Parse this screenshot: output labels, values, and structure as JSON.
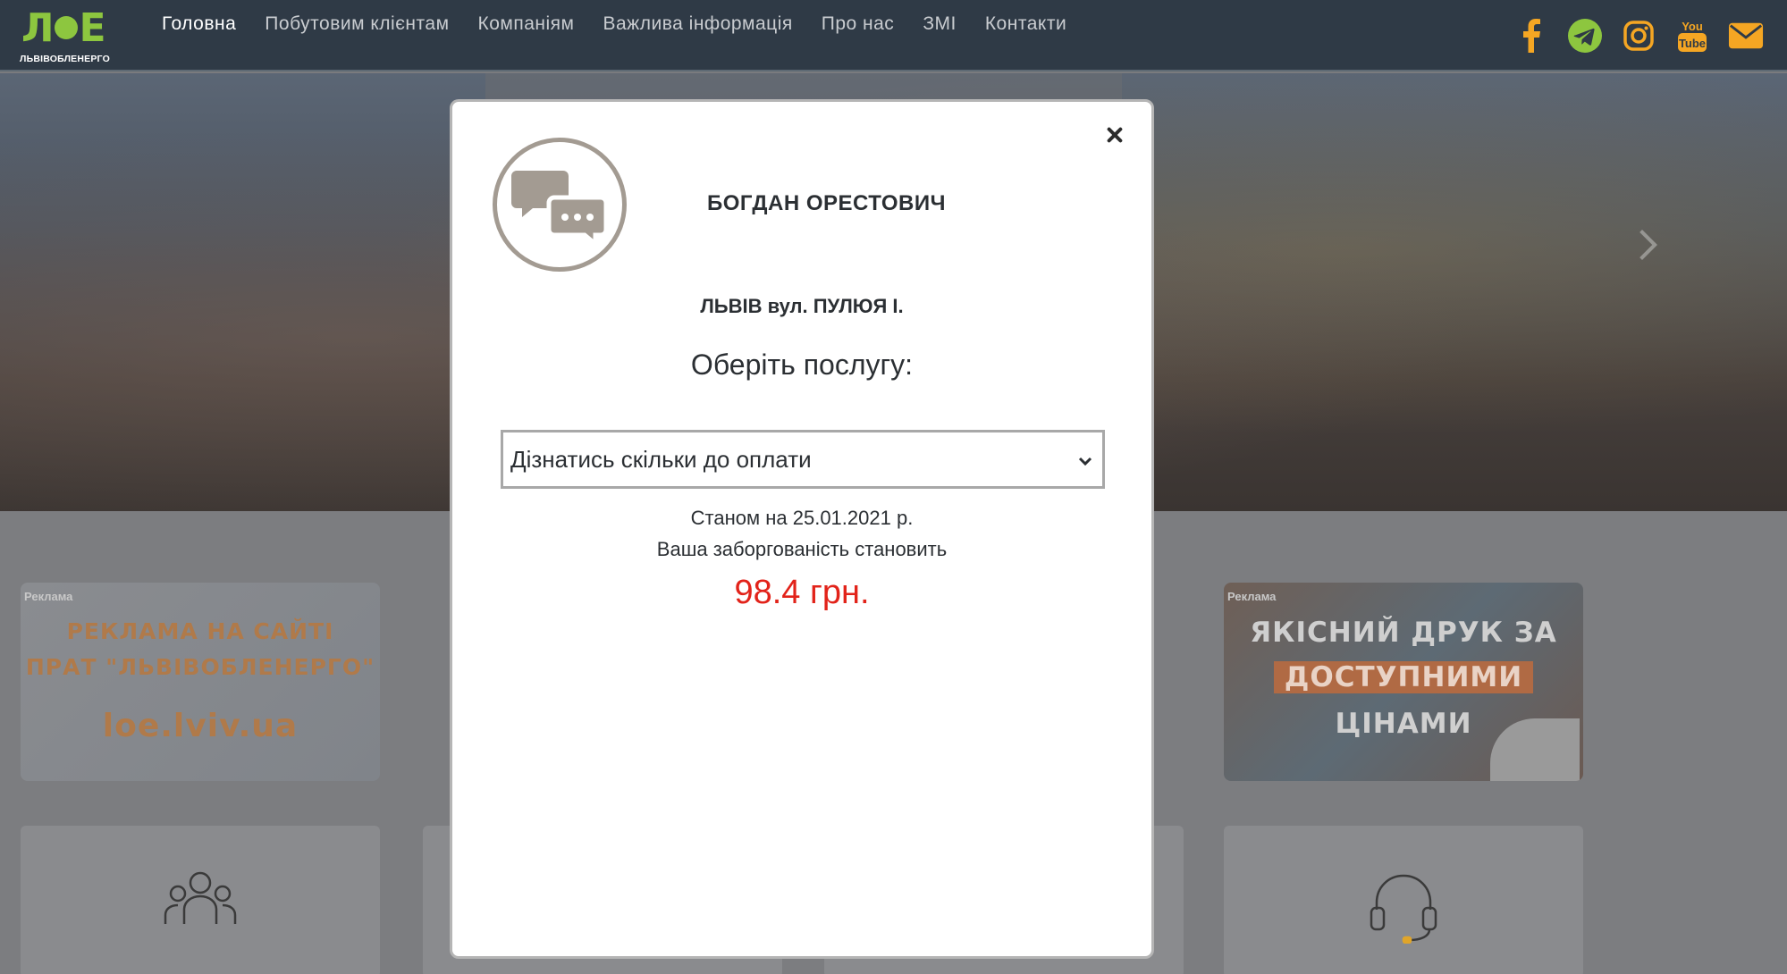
{
  "header": {
    "logo_mark": "ЛОЕ",
    "logo_text": "ЛЬВІВОБЛЕНЕРГО",
    "nav": [
      {
        "label": "Головна",
        "active": true
      },
      {
        "label": "Побутовим клієнтам",
        "active": false
      },
      {
        "label": "Компаніям",
        "active": false
      },
      {
        "label": "Важлива інформація",
        "active": false
      },
      {
        "label": "Про нас",
        "active": false
      },
      {
        "label": "ЗМІ",
        "active": false
      },
      {
        "label": "Контакти",
        "active": false
      }
    ],
    "social": [
      "facebook-icon",
      "telegram-icon",
      "instagram-icon",
      "youtube-icon",
      "mail-icon"
    ],
    "social_color": "#f5a623",
    "youtube_label_top": "You",
    "youtube_label_bottom": "Tube"
  },
  "ads": {
    "left": {
      "tag": "Реклама",
      "line1": "РЕКЛАМА НА САЙТІ",
      "line2": "ПРАТ \"ЛЬВІВОБЛЕНЕРГО\"",
      "line3": "loe.lviv.ua"
    },
    "right": {
      "tag": "Реклама",
      "line1": "ЯКІСНИЙ ДРУК ЗА",
      "line2": "ДОСТУПНИМИ",
      "line3": "ЦІНАМИ"
    }
  },
  "modal": {
    "user_name": "БОГДАН ОРЕСТОВИЧ",
    "address": "ЛЬВІВ вул. ПУЛЮЯ І.",
    "service_title": "Оберіть послугу:",
    "service_selected": "Дізнатись скільки до оплати",
    "as_of": "Станом на 25.01.2021 р.",
    "debt_label": "Ваша заборгованість становить",
    "debt_amount": "98.4 грн.",
    "debt_color": "#e2231a"
  }
}
